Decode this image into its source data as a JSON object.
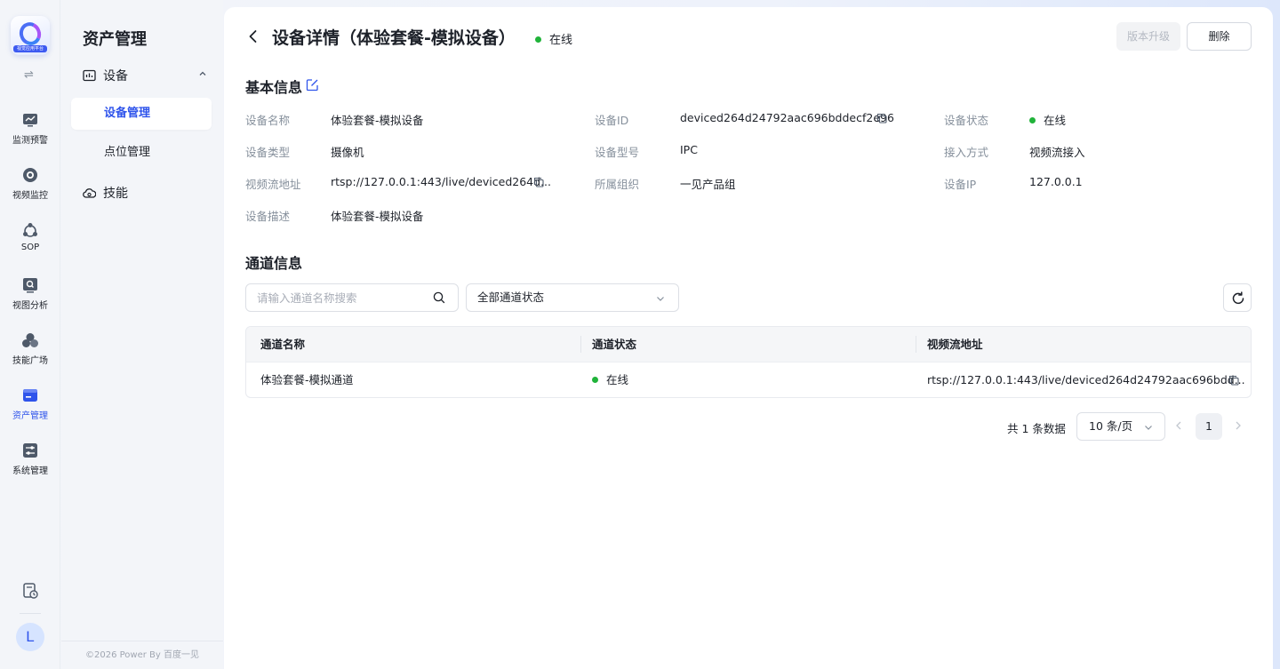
{
  "rail": {
    "logo_text": "视觉应用平台",
    "items": [
      {
        "label": "监测预警",
        "icon": "monitor-chart-icon"
      },
      {
        "label": "视频监控",
        "icon": "camera-lens-icon"
      },
      {
        "label": "SOP",
        "icon": "sop-flow-icon"
      },
      {
        "label": "视图分析",
        "icon": "view-analysis-icon"
      },
      {
        "label": "技能广场",
        "icon": "skill-square-icon"
      },
      {
        "label": "资产管理",
        "icon": "asset-management-icon"
      },
      {
        "label": "系统管理",
        "icon": "system-settings-icon"
      }
    ],
    "active_item": "资产管理",
    "avatar_letter": "L"
  },
  "submenu": {
    "title": "资产管理",
    "groups": [
      {
        "label": "设备",
        "icon": "device-icon",
        "expanded": true
      },
      {
        "label": "技能",
        "icon": "skill-cloud-icon"
      }
    ],
    "items": [
      {
        "label": "设备管理",
        "active": true
      },
      {
        "label": "点位管理",
        "active": false
      }
    ],
    "footer": "©2026 Power By 百度一见"
  },
  "header": {
    "title": "设备详情（体验套餐-模拟设备）",
    "status": "在线",
    "upgrade_label": "版本升级",
    "delete_label": "删除"
  },
  "basic_info": {
    "section_title": "基本信息",
    "fields": [
      {
        "label": "设备名称",
        "value": "体验套餐-模拟设备"
      },
      {
        "label": "设备ID",
        "value": "deviced264d24792aac696bddecf2e96"
      },
      {
        "label": "设备状态",
        "value": "在线"
      },
      {
        "label": "设备类型",
        "value": "摄像机"
      },
      {
        "label": "设备型号",
        "value": "IPC"
      },
      {
        "label": "接入方式",
        "value": "视频流接入"
      },
      {
        "label": "视频流地址",
        "value": "rtsp://127.0.0.1:443/live/deviced264d..."
      },
      {
        "label": "所属组织",
        "value": "一见产品组"
      },
      {
        "label": "设备IP",
        "value": "127.0.0.1"
      },
      {
        "label": "设备描述",
        "value": "体验套餐-模拟设备"
      }
    ]
  },
  "channel_info": {
    "section_title": "通道信息",
    "search_placeholder": "请输入通道名称搜索",
    "status_filter": "全部通道状态",
    "columns": [
      "通道名称",
      "通道状态",
      "视频流地址"
    ],
    "rows": [
      {
        "name": "体验套餐-模拟通道",
        "status": "在线",
        "stream": "rtsp://127.0.0.1:443/live/deviced264d24792aac696bdd..."
      }
    ]
  },
  "pagination": {
    "total_text": "共 1 条数据",
    "page_size": "10 条/页",
    "current_page": "1"
  },
  "colors": {
    "accent": "#2f54eb",
    "online": "#20b33a"
  }
}
